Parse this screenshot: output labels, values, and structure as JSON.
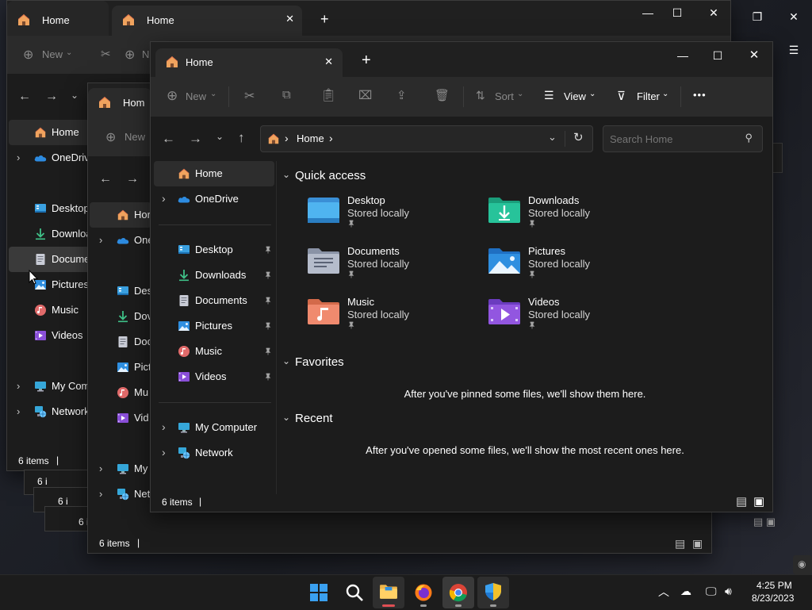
{
  "back_windows": {
    "w1": {
      "tabs": [
        {
          "label": "Home"
        },
        {
          "label": "Home"
        }
      ],
      "toolbar_new": "New",
      "toolbar_new_cut": "N",
      "nav": {
        "home": "Home",
        "onedrive": "OneDrive",
        "desktop": "Desktop",
        "downloads": "Downloa",
        "documents": "Documen",
        "pictures": "Pictures",
        "music": "Music",
        "videos": "Videos",
        "mycomputer": "My Comp",
        "network": "Network"
      },
      "status": "6 items",
      "status_stack": [
        "6 i",
        "6 i",
        "6 i"
      ]
    },
    "w2": {
      "tab_label": "Hom",
      "toolbar_new": "New",
      "nav": {
        "home": "Hor",
        "onedrive": "One",
        "desktop": "Des",
        "downloads": "Dov",
        "documents": "Doc",
        "pictures": "Pict",
        "music": "Mu",
        "videos": "Vid",
        "mycomputer": "My",
        "network": "Net"
      },
      "status": "6 items"
    }
  },
  "window": {
    "tab_label": "Home",
    "new_tab_glyph": "+",
    "close_tab_glyph": "✕",
    "caption": {
      "minimize": "—",
      "maximize": "☐",
      "close": "✕"
    },
    "toolbar": {
      "new": "New",
      "sort": "Sort",
      "view": "View",
      "filter": "Filter",
      "more": "•••"
    },
    "address": {
      "segment": "Home",
      "sep1": "›",
      "sep2": "›"
    },
    "search_placeholder": "Search Home",
    "sidebar": {
      "home": "Home",
      "onedrive": "OneDrive",
      "pinned": [
        {
          "label": "Desktop"
        },
        {
          "label": "Downloads"
        },
        {
          "label": "Documents"
        },
        {
          "label": "Pictures"
        },
        {
          "label": "Music"
        },
        {
          "label": "Videos"
        }
      ],
      "mycomputer": "My Computer",
      "network": "Network"
    },
    "sections": {
      "quick_access": "Quick access",
      "favorites": "Favorites",
      "recent": "Recent"
    },
    "quick_access": [
      {
        "name": "Desktop",
        "sub": "Stored locally"
      },
      {
        "name": "Downloads",
        "sub": "Stored locally"
      },
      {
        "name": "Documents",
        "sub": "Stored locally"
      },
      {
        "name": "Pictures",
        "sub": "Stored locally"
      },
      {
        "name": "Music",
        "sub": "Stored locally"
      },
      {
        "name": "Videos",
        "sub": "Stored locally"
      }
    ],
    "favorites_empty": "After you've pinned some files, we'll show them here.",
    "recent_empty": "After you've opened some files, we'll show the most recent ones here.",
    "status": "6 items"
  },
  "taskbar": {
    "apps": [
      "start-icon",
      "search-icon",
      "file-explorer-icon",
      "firefox-icon",
      "chrome-icon",
      "security-shield-icon"
    ],
    "time": "4:25 PM",
    "date": "8/23/2023"
  },
  "colors": {
    "accent": "#4cc2ff",
    "window_bg": "#1c1c1c",
    "toolbar_bg": "#2b2b2b",
    "selected": "#2d2d2d"
  }
}
